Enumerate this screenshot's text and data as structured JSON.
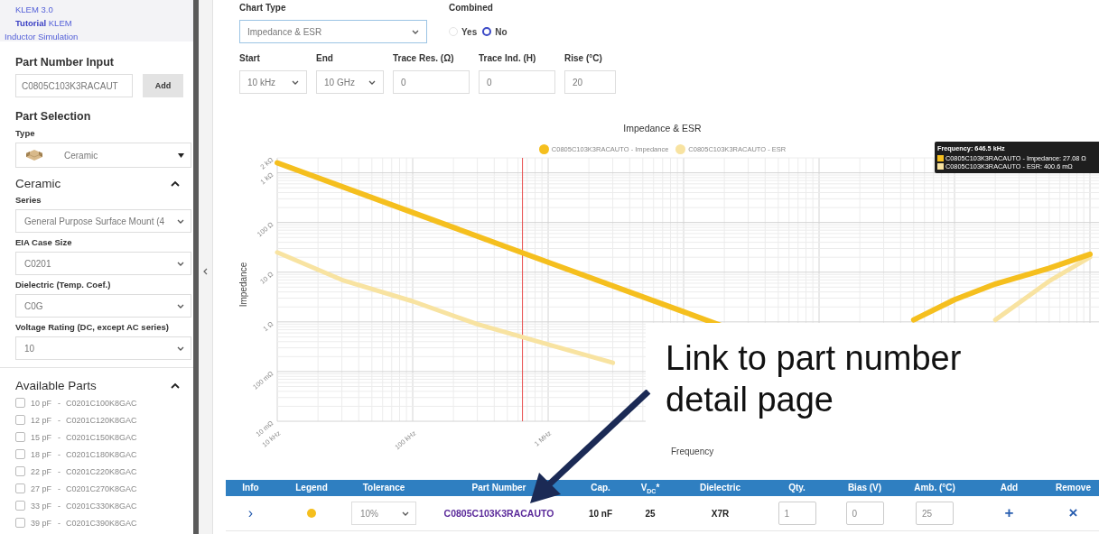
{
  "header_links": [
    {
      "text": "KLEM 3.0"
    },
    {
      "text": "**Tutorial** KLEM"
    },
    {
      "text": "Inductor Simulation"
    }
  ],
  "sidebar": {
    "part_number_input": {
      "title": "Part Number Input",
      "value": "C0805C103K3RACAUT",
      "button": "Add"
    },
    "part_selection": {
      "title": "Part Selection",
      "type_label": "Type",
      "type_value": "Ceramic"
    },
    "ceramic": {
      "title": "Ceramic",
      "expanded": true,
      "fields": [
        {
          "label": "Series",
          "value": "General Purpose Surface Mount (4"
        },
        {
          "label": "EIA Case Size",
          "value": "C0201"
        },
        {
          "label": "Dielectric (Temp. Coef.)",
          "value": "C0G"
        },
        {
          "label": "Voltage Rating (DC, except AC series)",
          "value": "10"
        }
      ]
    },
    "available_parts": {
      "title": "Available Parts",
      "expanded": true,
      "items": [
        {
          "capacitance": "10 pF",
          "dash": "-",
          "part": "C0201C100K8GAC",
          "checked": false
        },
        {
          "capacitance": "12 pF",
          "dash": "-",
          "part": "C0201C120K8GAC",
          "checked": false
        },
        {
          "capacitance": "15 pF",
          "dash": "-",
          "part": "C0201C150K8GAC",
          "checked": false
        },
        {
          "capacitance": "18 pF",
          "dash": "-",
          "part": "C0201C180K8GAC",
          "checked": false
        },
        {
          "capacitance": "22 pF",
          "dash": "-",
          "part": "C0201C220K8GAC",
          "checked": false
        },
        {
          "capacitance": "27 pF",
          "dash": "-",
          "part": "C0201C270K8GAC",
          "checked": false
        },
        {
          "capacitance": "33 pF",
          "dash": "-",
          "part": "C0201C330K8GAC",
          "checked": false
        },
        {
          "capacitance": "39 pF",
          "dash": "-",
          "part": "C0201C390K8GAC",
          "checked": false
        }
      ]
    }
  },
  "controls": {
    "chart_type": {
      "label": "Chart Type",
      "value": "Impedance & ESR"
    },
    "combined": {
      "label": "Combined",
      "options": [
        {
          "label": "Yes",
          "selected": false
        },
        {
          "label": "No",
          "selected": true
        }
      ]
    },
    "fields": [
      {
        "kind": "select",
        "label": "Start",
        "value": "10 kHz"
      },
      {
        "kind": "select",
        "label": "End",
        "value": "10 GHz"
      },
      {
        "kind": "input",
        "label": "Trace Res. (Ω)",
        "value": "0"
      },
      {
        "kind": "input",
        "label": "Trace Ind. (H)",
        "value": "0"
      },
      {
        "kind": "input",
        "label": "Rise (°C)",
        "value": "20"
      }
    ]
  },
  "chart": {
    "title": "Impedance & ESR",
    "x_axis_title": "Frequency",
    "y_axis_title": "Impedance",
    "legend": [
      {
        "label": "C0805C103K3RACAUTO - Impedance",
        "color": "#f5bf1e"
      },
      {
        "label": "C0805C103K3RACAUTO - ESR",
        "color": "#f8e3a1"
      }
    ],
    "x_axis_labels": [
      "10 kHz",
      "100 kHz",
      "1 MHz"
    ],
    "y_axis_labels": [
      "2 kΩ",
      "1 kΩ",
      "100 Ω",
      "10 Ω",
      "1 Ω",
      "100 mΩ",
      "10 mΩ"
    ],
    "tooltip": {
      "title": "Frequency: 646.5 kHz",
      "rows": [
        {
          "text": "C0805C103K3RACAUTO - Impedance: 27.08 Ω",
          "color": "#f5bf1e"
        },
        {
          "text": "C0805C103K3RACAUTO - ESR: 400.6 mΩ",
          "color": "#f8e3a1"
        }
      ]
    }
  },
  "table": {
    "columns": [
      "Info",
      "Legend",
      "Tolerance",
      "Part Number",
      "Cap.",
      "V$_{DC}$*",
      "Dielectric",
      "Qty.",
      "Bias (V)",
      "Amb. (°C)",
      "Add",
      "Remove"
    ],
    "rows": [
      {
        "info": "›",
        "color": "#f5bf1e",
        "tolerance": "10%",
        "part_number": "C0805C103K3RACAUTO",
        "cap": "10 nF",
        "vdc": "25",
        "dielectric": "X7R",
        "qty": "1",
        "bias": "0",
        "amb": "25",
        "add": "+",
        "remove": "×"
      }
    ]
  },
  "callout": {
    "text": "Link to part number detail page"
  }
}
